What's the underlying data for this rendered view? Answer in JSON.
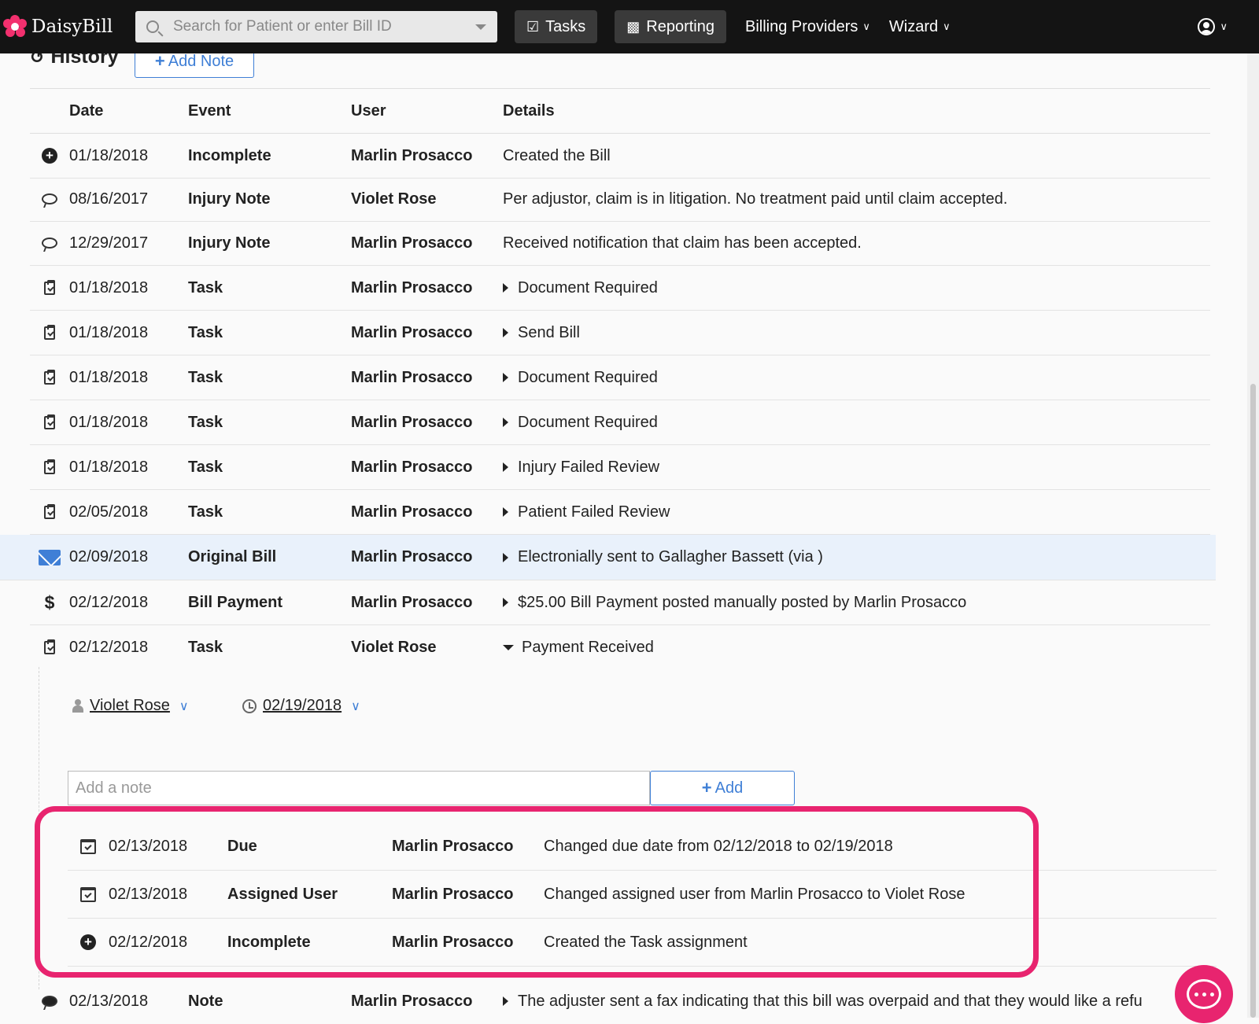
{
  "header": {
    "app_name": "DaisyBill",
    "search_placeholder": "Search for Patient or enter Bill ID",
    "tasks_label": "Tasks",
    "reporting_label": "Reporting",
    "billing_providers_label": "Billing Providers",
    "wizard_label": "Wizard",
    "brand_color": "#e8246f"
  },
  "history": {
    "title": "History",
    "add_note_label": "Add Note",
    "columns": {
      "date": "Date",
      "event": "Event",
      "user": "User",
      "details": "Details"
    },
    "rows": [
      {
        "icon": "plus-circle-icon",
        "date": "01/18/2018",
        "event": "Incomplete",
        "user": "Marlin Prosacco",
        "details": "Created the Bill",
        "expand": "none"
      },
      {
        "icon": "speech-bubble-icon",
        "date": "08/16/2017",
        "event": "Injury Note",
        "user": "Violet Rose",
        "details": "Per adjustor, claim is in litigation. No treatment paid until claim accepted.",
        "expand": "none"
      },
      {
        "icon": "speech-bubble-icon",
        "date": "12/29/2017",
        "event": "Injury Note",
        "user": "Marlin Prosacco",
        "details": "Received notification that claim has been accepted.",
        "expand": "none"
      },
      {
        "icon": "clipboard-check-icon",
        "date": "01/18/2018",
        "event": "Task",
        "user": "Marlin Prosacco",
        "details": "Document Required",
        "expand": "collapsed"
      },
      {
        "icon": "clipboard-check-icon",
        "date": "01/18/2018",
        "event": "Task",
        "user": "Marlin Prosacco",
        "details": "Send Bill",
        "expand": "collapsed"
      },
      {
        "icon": "clipboard-check-icon",
        "date": "01/18/2018",
        "event": "Task",
        "user": "Marlin Prosacco",
        "details": "Document Required",
        "expand": "collapsed"
      },
      {
        "icon": "clipboard-check-icon",
        "date": "01/18/2018",
        "event": "Task",
        "user": "Marlin Prosacco",
        "details": "Document Required",
        "expand": "collapsed"
      },
      {
        "icon": "clipboard-check-icon",
        "date": "01/18/2018",
        "event": "Task",
        "user": "Marlin Prosacco",
        "details": "Injury Failed Review",
        "expand": "collapsed"
      },
      {
        "icon": "clipboard-check-icon",
        "date": "02/05/2018",
        "event": "Task",
        "user": "Marlin Prosacco",
        "details": "Patient Failed Review",
        "expand": "collapsed"
      },
      {
        "icon": "envelope-icon",
        "date": "02/09/2018",
        "event": "Original Bill",
        "user": "Marlin Prosacco",
        "details": "Electronially sent to Gallagher Bassett (via )",
        "expand": "collapsed"
      },
      {
        "icon": "dollar-icon",
        "date": "02/12/2018",
        "event": "Bill Payment",
        "user": "Marlin Prosacco",
        "details": "$25.00 Bill Payment posted manually posted by Marlin Prosacco",
        "expand": "collapsed"
      },
      {
        "icon": "clipboard-check-icon",
        "date": "02/12/2018",
        "event": "Task",
        "user": "Violet Rose",
        "details": "Payment Received",
        "expand": "expanded"
      }
    ]
  },
  "task_detail": {
    "assignee": "Violet Rose",
    "due_date": "02/19/2018",
    "note_placeholder": "Add a note",
    "add_label": "Add",
    "rows": [
      {
        "icon": "calendar-check-icon",
        "date": "02/13/2018",
        "event": "Due",
        "user": "Marlin Prosacco",
        "details": "Changed due date from 02/12/2018 to 02/19/2018"
      },
      {
        "icon": "calendar-check-icon",
        "date": "02/13/2018",
        "event": "Assigned User",
        "user": "Marlin Prosacco",
        "details": "Changed assigned user from Marlin Prosacco to Violet Rose"
      },
      {
        "icon": "plus-circle-icon",
        "date": "02/12/2018",
        "event": "Incomplete",
        "user": "Marlin Prosacco",
        "details": "Created the Task assignment"
      }
    ]
  },
  "last_row": {
    "icon": "speech-bubble-filled-icon",
    "date": "02/13/2018",
    "event": "Note",
    "user": "Marlin Prosacco",
    "details": "The adjuster sent a fax indicating that this bill was overpaid and that they would like a refu"
  }
}
